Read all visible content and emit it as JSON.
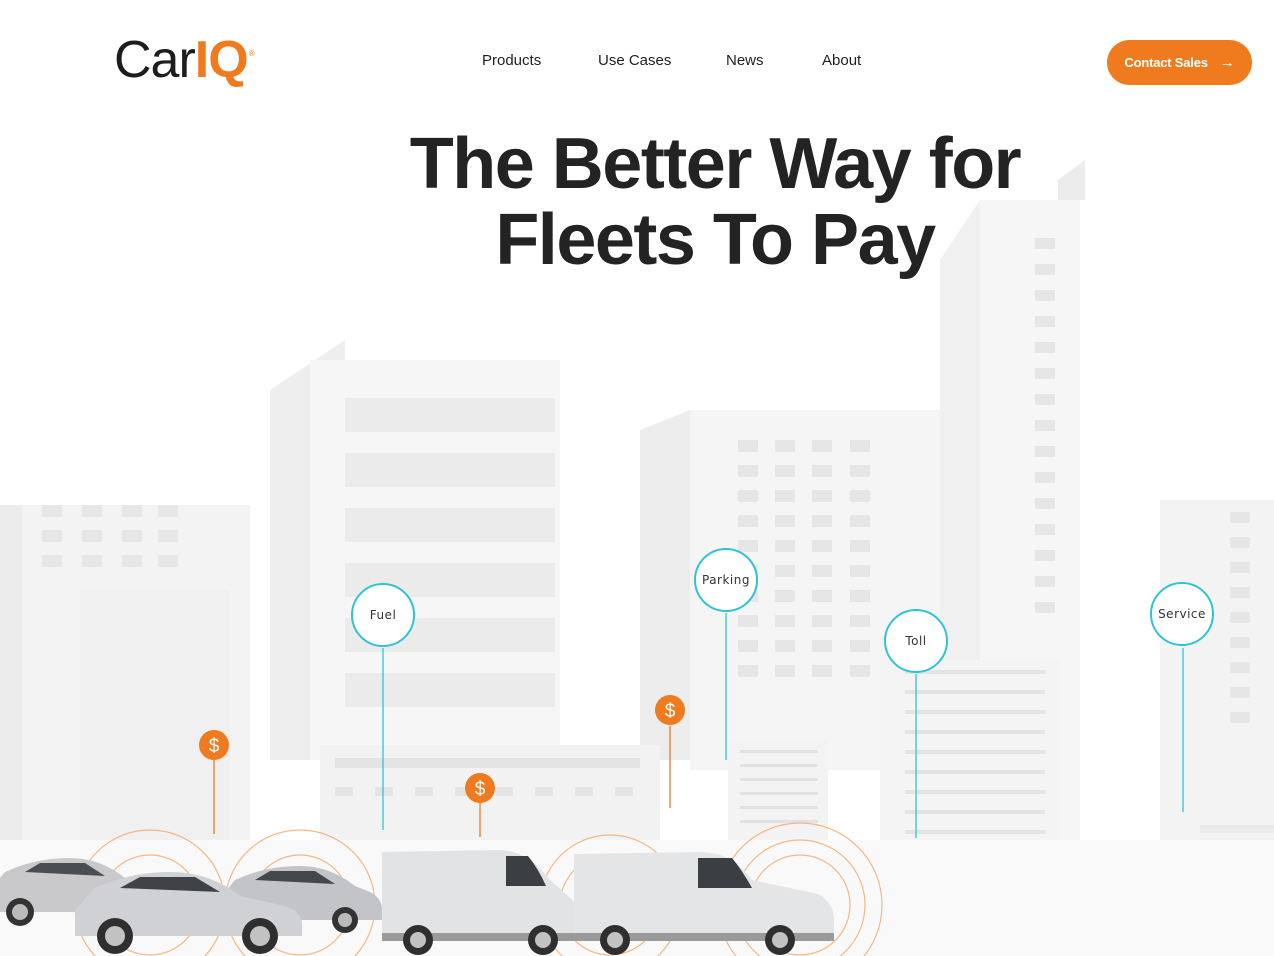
{
  "brand": {
    "name_part1": "Car",
    "name_part2": "IQ",
    "trademark": "®"
  },
  "nav": {
    "items": [
      "Products",
      "Use Cases",
      "News",
      "About"
    ]
  },
  "cta": {
    "label": "Contact Sales",
    "icon": "arrow-right-icon"
  },
  "hero": {
    "title_line1": "The Better Way for",
    "title_line2": "Fleets To Pay"
  },
  "payment_points": [
    "Fuel",
    "Parking",
    "Toll",
    "Service"
  ],
  "dollar_symbol": "$",
  "colors": {
    "accent": "#f07b1f",
    "bubble_border": "#2ec4d6",
    "title": "#232323",
    "building": "#f1f1f1"
  }
}
